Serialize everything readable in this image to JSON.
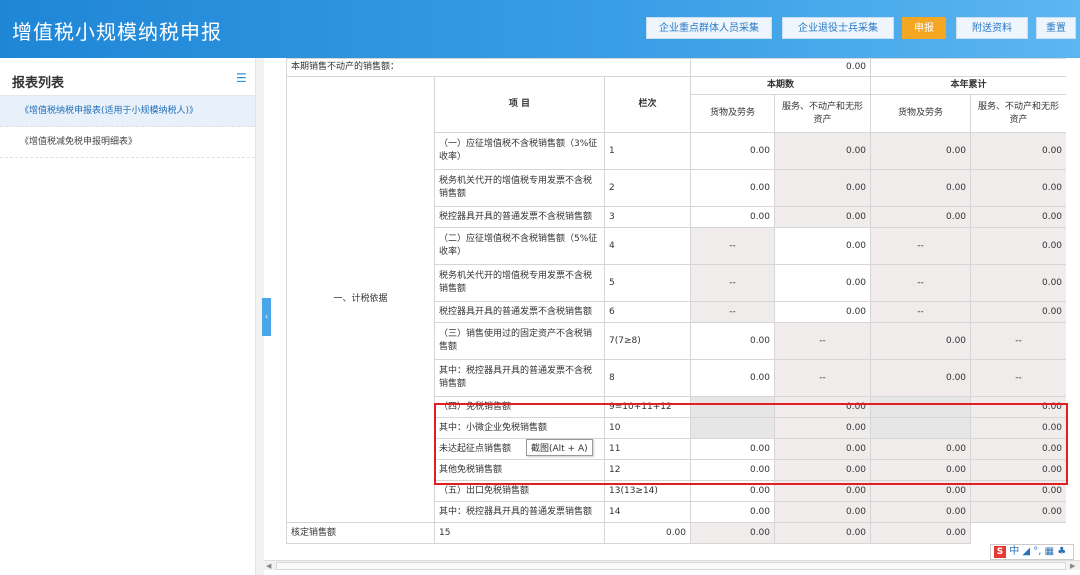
{
  "header": {
    "title": "增值税小规模纳税申报",
    "buttons": [
      {
        "label": "企业重点群体人员采集"
      },
      {
        "label": "企业退役士兵采集"
      },
      {
        "label": "申报"
      },
      {
        "label": "附送资料"
      },
      {
        "label": "重置"
      }
    ]
  },
  "sidebar": {
    "title": "报表列表",
    "items": [
      {
        "label": "《增值税纳税申报表(适用于小规模纳税人)》"
      },
      {
        "label": "《增值税减免税申报明细表》"
      }
    ]
  },
  "table": {
    "top_row_label": "本期销售不动产的销售额：",
    "top_row_value": "0.00",
    "headers": {
      "item": "项  目",
      "line": "栏次",
      "current": "本期数",
      "ytd": "本年累计",
      "goods": "货物及劳务",
      "services": "服务、不动产和无形资产"
    },
    "section_label": "一、计税依据",
    "rows": [
      {
        "item": "（一）应征增值税不含税销售额（3%征收率）",
        "line": "1",
        "c1": "0.00",
        "c2": "0.00",
        "c3": "0.00",
        "c4": "0.00"
      },
      {
        "item": "税务机关代开的增值税专用发票不含税销售额",
        "line": "2",
        "c1": "0.00",
        "c2": "0.00",
        "c3": "0.00",
        "c4": "0.00"
      },
      {
        "item": "税控器具开具的普通发票不含税销售额",
        "line": "3",
        "c1": "0.00",
        "c2": "0.00",
        "c3": "0.00",
        "c4": "0.00"
      },
      {
        "item": "（二）应征增值税不含税销售额（5%征收率）",
        "line": "4",
        "c1": "--",
        "c2": "0.00",
        "c3": "--",
        "c4": "0.00"
      },
      {
        "item": "税务机关代开的增值税专用发票不含税销售额",
        "line": "5",
        "c1": "--",
        "c2": "0.00",
        "c3": "--",
        "c4": "0.00"
      },
      {
        "item": "税控器具开具的普通发票不含税销售额",
        "line": "6",
        "c1": "--",
        "c2": "0.00",
        "c3": "--",
        "c4": "0.00"
      },
      {
        "item": "（三）销售使用过的固定资产不含税销售额",
        "line": "7(7≥8)",
        "c1": "0.00",
        "c2": "--",
        "c3": "0.00",
        "c4": "--"
      },
      {
        "item": "其中：税控器具开具的普通发票不含税销售额",
        "line": "8",
        "c1": "0.00",
        "c2": "--",
        "c3": "0.00",
        "c4": "--"
      },
      {
        "item": "（四）免税销售额",
        "line": "9=10+11+12",
        "c1": "",
        "c2": "0.00",
        "c3": "",
        "c4": "0.00"
      },
      {
        "item": "其中：小微企业免税销售额",
        "line": "10",
        "c1": "",
        "c2": "0.00",
        "c3": "",
        "c4": "0.00"
      },
      {
        "item": "未达起征点销售额",
        "line": "11",
        "c1": "0.00",
        "c2": "0.00",
        "c3": "0.00",
        "c4": "0.00"
      },
      {
        "item": "其他免税销售额",
        "line": "12",
        "c1": "0.00",
        "c2": "0.00",
        "c3": "0.00",
        "c4": "0.00"
      },
      {
        "item": "（五）出口免税销售额",
        "line": "13(13≥14)",
        "c1": "0.00",
        "c2": "0.00",
        "c3": "0.00",
        "c4": "0.00"
      },
      {
        "item": "其中：税控器具开具的普通发票销售额",
        "line": "14",
        "c1": "0.00",
        "c2": "0.00",
        "c3": "0.00",
        "c4": "0.00"
      },
      {
        "item": "核定销售额",
        "line": "15",
        "c1": "0.00",
        "c2": "0.00",
        "c3": "0.00",
        "c4": "0.00"
      }
    ]
  },
  "tooltip": "截图(Alt + A)",
  "ime": {
    "s": "S",
    "text": "中 ◢ °, ▦ ♣"
  },
  "colors": {
    "header_blue": "#1f86d6",
    "active_orange": "#f5a623",
    "highlight_red": "#e02020"
  }
}
